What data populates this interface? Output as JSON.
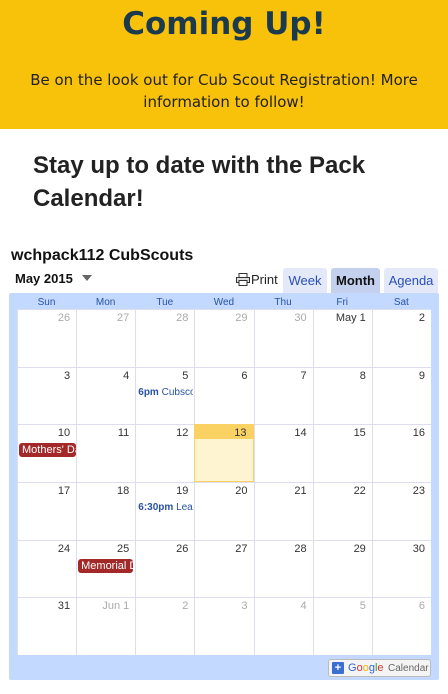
{
  "banner": {
    "title": "Coming Up!",
    "text": "Be on the look out for Cub Scout Registration! More information to follow!",
    "bg_color": "#f8c10a"
  },
  "section": {
    "heading": "Stay up to date with the Pack Calendar!"
  },
  "calendar": {
    "name": "wchpack112 CubScouts",
    "month_label": "May 2015",
    "print_label": "Print",
    "tabs": [
      {
        "label": "Week",
        "active": false
      },
      {
        "label": "Month",
        "active": true
      },
      {
        "label": "Agenda",
        "active": false
      }
    ],
    "weekdays": [
      "Sun",
      "Mon",
      "Tue",
      "Wed",
      "Thu",
      "Fri",
      "Sat"
    ],
    "weeks": [
      [
        {
          "d": "26",
          "other": true
        },
        {
          "d": "27",
          "other": true
        },
        {
          "d": "28",
          "other": true
        },
        {
          "d": "29",
          "other": true
        },
        {
          "d": "30",
          "other": true
        },
        {
          "d": "May 1"
        },
        {
          "d": "2"
        }
      ],
      [
        {
          "d": "3"
        },
        {
          "d": "4"
        },
        {
          "d": "5",
          "event": {
            "kind": "timed",
            "time": "6pm",
            "title": "Cubscouts"
          }
        },
        {
          "d": "6"
        },
        {
          "d": "7"
        },
        {
          "d": "8"
        },
        {
          "d": "9"
        }
      ],
      [
        {
          "d": "10",
          "event": {
            "kind": "allday",
            "title": "Mothers' Day"
          }
        },
        {
          "d": "11"
        },
        {
          "d": "12"
        },
        {
          "d": "13",
          "today": true
        },
        {
          "d": "14"
        },
        {
          "d": "15"
        },
        {
          "d": "16"
        }
      ],
      [
        {
          "d": "17"
        },
        {
          "d": "18"
        },
        {
          "d": "19",
          "event": {
            "kind": "timed",
            "time": "6:30pm",
            "title": "Leaders"
          }
        },
        {
          "d": "20"
        },
        {
          "d": "21"
        },
        {
          "d": "22"
        },
        {
          "d": "23"
        }
      ],
      [
        {
          "d": "24"
        },
        {
          "d": "25",
          "event": {
            "kind": "allday",
            "title": "Memorial Day"
          }
        },
        {
          "d": "26"
        },
        {
          "d": "27"
        },
        {
          "d": "28"
        },
        {
          "d": "29"
        },
        {
          "d": "30"
        }
      ],
      [
        {
          "d": "31"
        },
        {
          "d": "Jun 1",
          "other": true
        },
        {
          "d": "2",
          "other": true
        },
        {
          "d": "3",
          "other": true
        },
        {
          "d": "4",
          "other": true
        },
        {
          "d": "5",
          "other": true
        },
        {
          "d": "6",
          "other": true
        }
      ]
    ],
    "footer_button": {
      "brand": "Google",
      "label": "Calendar",
      "icon": "plus-icon"
    },
    "colors": {
      "frame": "#c3d9ff",
      "event_chip": "#a32929",
      "today": "#fad163",
      "link": "#2952a3"
    }
  }
}
